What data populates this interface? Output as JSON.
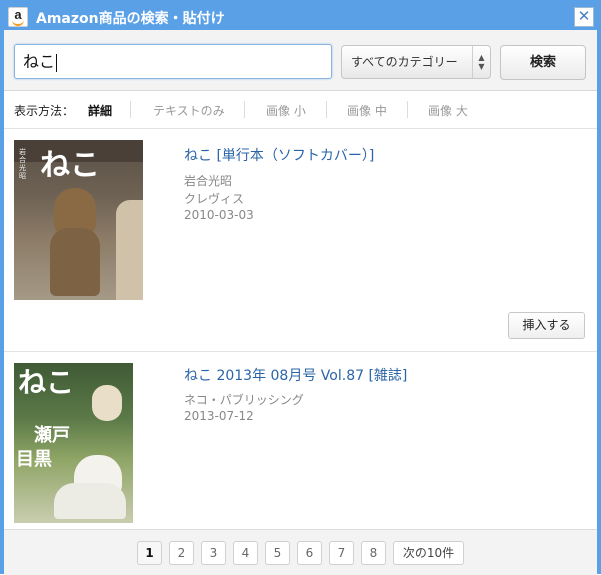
{
  "window": {
    "title": "Amazon商品の検索・貼付け",
    "logo_letter": "a",
    "close_glyph": "✕",
    "accent_color": "#5aa0e6"
  },
  "search": {
    "query": "ねこ",
    "category": "すべてのカテゴリー",
    "submit_label": "検索"
  },
  "view": {
    "label": "表示方法：",
    "options": [
      "詳細",
      "テキストのみ",
      "画像 小",
      "画像 中",
      "画像 大"
    ],
    "selected": "詳細"
  },
  "results": [
    {
      "title": "ねこ [単行本（ソフトカバー）]",
      "author": "岩合光昭",
      "publisher": "クレヴィス",
      "date": "2010-03-03",
      "cover_text": "ねこ",
      "cover_side_text": "岩合光昭",
      "insert_label": "挿入する"
    },
    {
      "title": "ねこ 2013年 08月号 Vol.87 [雑誌]",
      "publisher": "ネコ・パブリッシング",
      "date": "2013-07-12",
      "cover_text": "ねこ",
      "cover_text_a": "瀬戸",
      "cover_text_b": "目黒"
    }
  ],
  "pager": {
    "pages": [
      "1",
      "2",
      "3",
      "4",
      "5",
      "6",
      "7",
      "8"
    ],
    "current": "1",
    "next_label": "次の10件"
  }
}
